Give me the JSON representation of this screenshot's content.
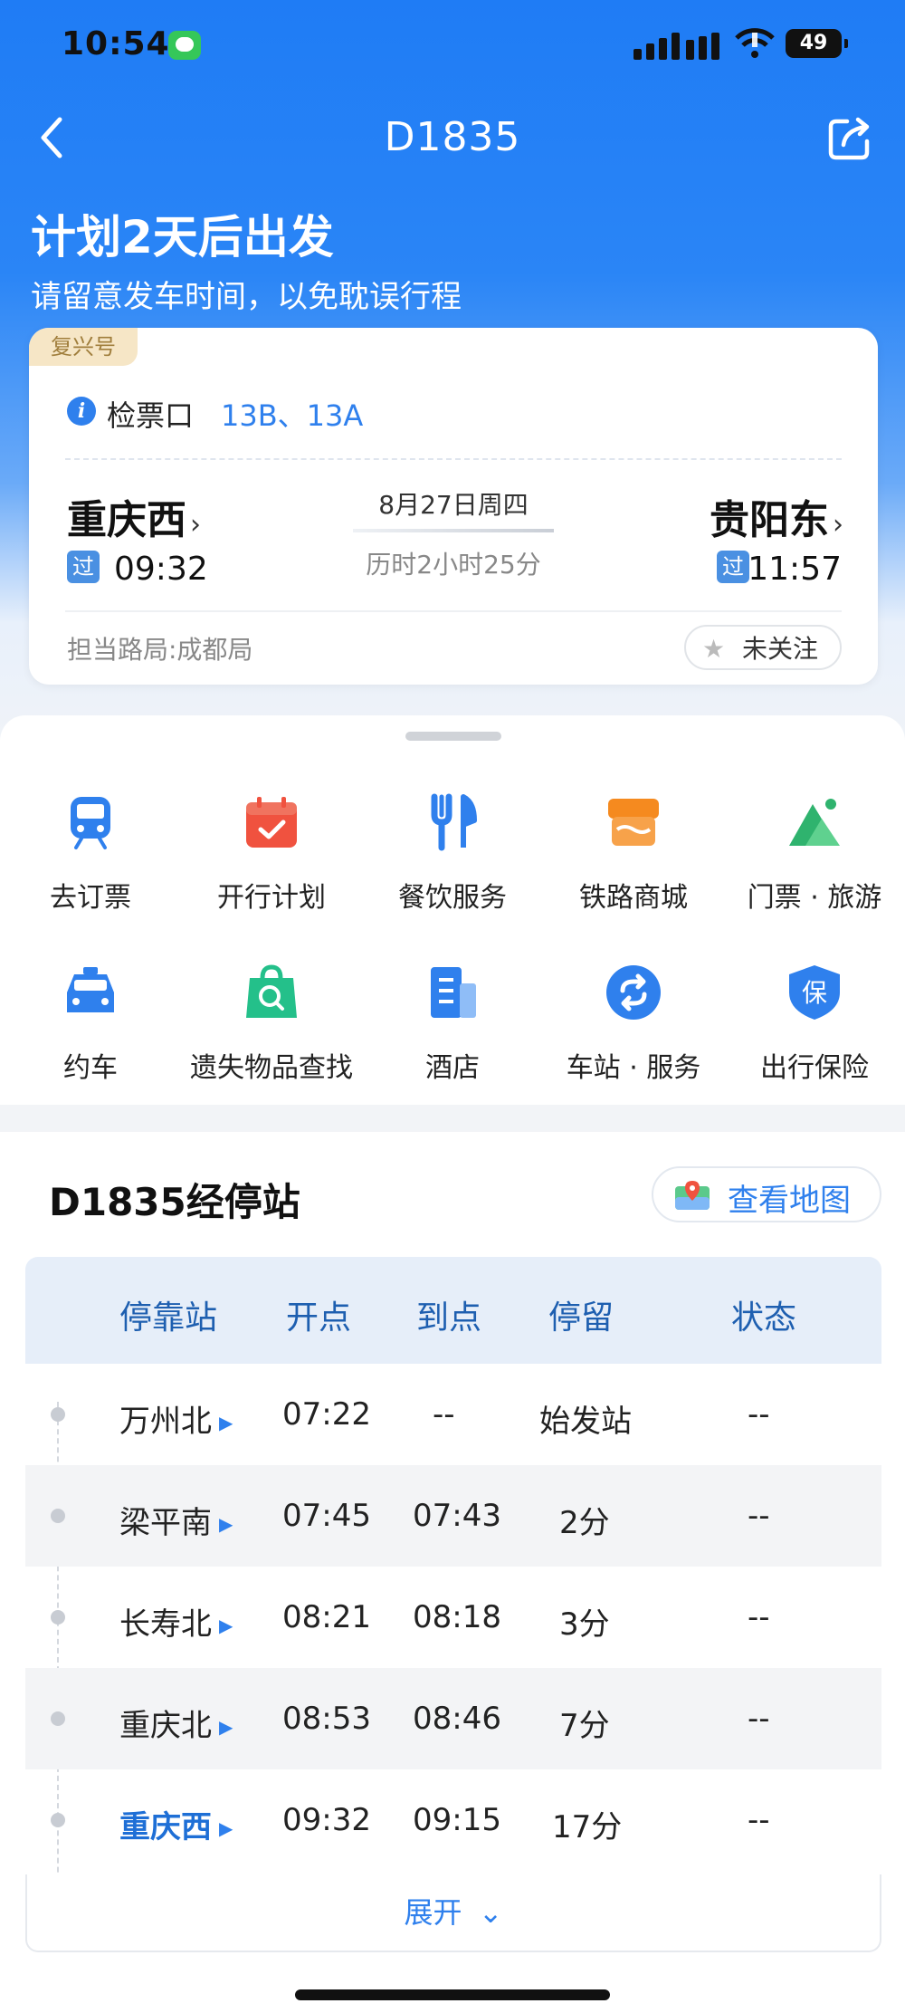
{
  "status_bar": {
    "time": "10:54",
    "battery": "49"
  },
  "nav": {
    "title": "D1835"
  },
  "hero": {
    "headline": "计划2天后出发",
    "subline": "请留意发车时间，以免耽误行程"
  },
  "card": {
    "train_type": "复兴号",
    "gate_label": "检票口",
    "gate_value": "13B、13A",
    "from_station": "重庆西",
    "to_station": "贵阳东",
    "date": "8月27日周四",
    "duration": "历时2小时25分",
    "pass_tag": "过",
    "from_time": "09:32",
    "to_time": "11:57",
    "bureau": "担当路局:成都局",
    "follow_label": "未关注",
    "arrow": "›"
  },
  "services": [
    {
      "label": "去订票",
      "icon": "train-icon",
      "color": "#2f80ed"
    },
    {
      "label": "开行计划",
      "icon": "calendar-icon",
      "color": "#f0523f"
    },
    {
      "label": "餐饮服务",
      "icon": "fork-knife-icon",
      "color": "#2f80ed"
    },
    {
      "label": "铁路商城",
      "icon": "shop-icon",
      "color": "#f58a1f"
    },
    {
      "label": "门票 · 旅游",
      "icon": "mountain-icon",
      "color": "#2fb36e"
    },
    {
      "label": "约车",
      "icon": "car-icon",
      "color": "#2f80ed"
    },
    {
      "label": "遗失物品查找",
      "icon": "bag-search-icon",
      "color": "#24c08a"
    },
    {
      "label": "酒店",
      "icon": "hotel-icon",
      "color": "#2f80ed"
    },
    {
      "label": "车站 · 服务",
      "icon": "refresh-icon",
      "color": "#2f80ed"
    },
    {
      "label": "出行保险",
      "icon": "shield-icon",
      "color": "#2f80ed",
      "glyph": "保"
    }
  ],
  "stops": {
    "title": "D1835经停站",
    "map_button": "查看地图",
    "headers": [
      "停靠站",
      "开点",
      "到点",
      "停留",
      "状态"
    ],
    "rows": [
      {
        "station": "万州北",
        "depart": "07:22",
        "arrive": "--",
        "stay": "始发站",
        "status": "--"
      },
      {
        "station": "梁平南",
        "depart": "07:45",
        "arrive": "07:43",
        "stay": "2分",
        "status": "--"
      },
      {
        "station": "长寿北",
        "depart": "08:21",
        "arrive": "08:18",
        "stay": "3分",
        "status": "--"
      },
      {
        "station": "重庆北",
        "depart": "08:53",
        "arrive": "08:46",
        "stay": "7分",
        "status": "--"
      },
      {
        "station": "重庆西",
        "depart": "09:32",
        "arrive": "09:15",
        "stay": "17分",
        "status": "--"
      }
    ],
    "expand_label": "展开",
    "expand_chevron": "⌄"
  },
  "colors": {
    "accent": "#2f80ed",
    "header_blue": "#1f7cf5"
  }
}
